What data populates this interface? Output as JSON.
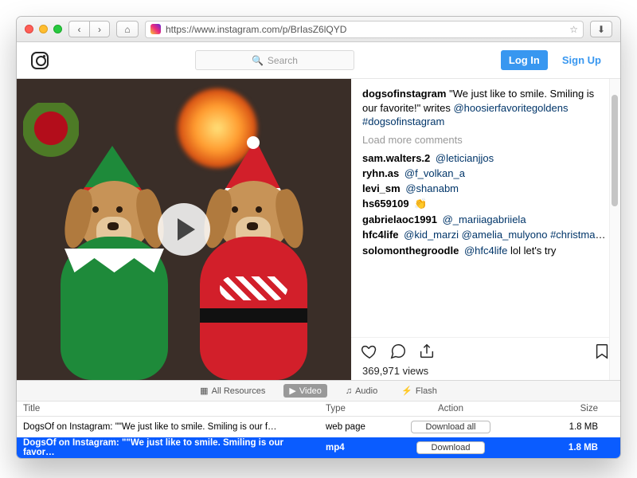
{
  "browser": {
    "url": "https://www.instagram.com/p/BrIasZ6lQYD"
  },
  "ig": {
    "search_placeholder": "Search",
    "login": "Log In",
    "signup": "Sign Up",
    "post": {
      "author": "dogsofinstagram",
      "caption": "\"We just like to smile. Smiling is our favorite!\" writes",
      "caption_mention": "@hoosierfavoritegoldens",
      "caption_hashtag": "#dogsofinstagram",
      "load_more": "Load more comments",
      "views": "369,971 views",
      "comments": [
        {
          "user": "sam.walters.2",
          "body": "@leticianjjos"
        },
        {
          "user": "ryhn.as",
          "body": "@f_volkan_a"
        },
        {
          "user": "levi_sm",
          "body": "@shanabm"
        },
        {
          "user": "hs659109",
          "body": "👏"
        },
        {
          "user": "gabrielaoc1991",
          "body": "@_mariiagabriiela"
        },
        {
          "user": "hfc4life",
          "body": "@kid_marzi @amelia_mulyono #christmasgoals for next year to get @solomonthegroodle to be like this 😉"
        },
        {
          "user": "solomonthegroodle",
          "body": "@hfc4life lol let's try"
        }
      ]
    }
  },
  "devbar": {
    "tabs": {
      "all": "All Resources",
      "video": "Video",
      "audio": "Audio",
      "flash": "Flash"
    }
  },
  "table": {
    "headers": {
      "title": "Title",
      "type": "Type",
      "action": "Action",
      "size": "Size"
    },
    "rows": [
      {
        "title": "DogsOf on Instagram: \"\"We just like to smile. Smiling is our f…",
        "type": "web page",
        "action": "Download all",
        "size": "1.8 MB"
      },
      {
        "title": "DogsOf on Instagram: \"\"We just like to smile. Smiling is our favor…",
        "type": "mp4",
        "action": "Download",
        "size": "1.8 MB"
      }
    ]
  }
}
